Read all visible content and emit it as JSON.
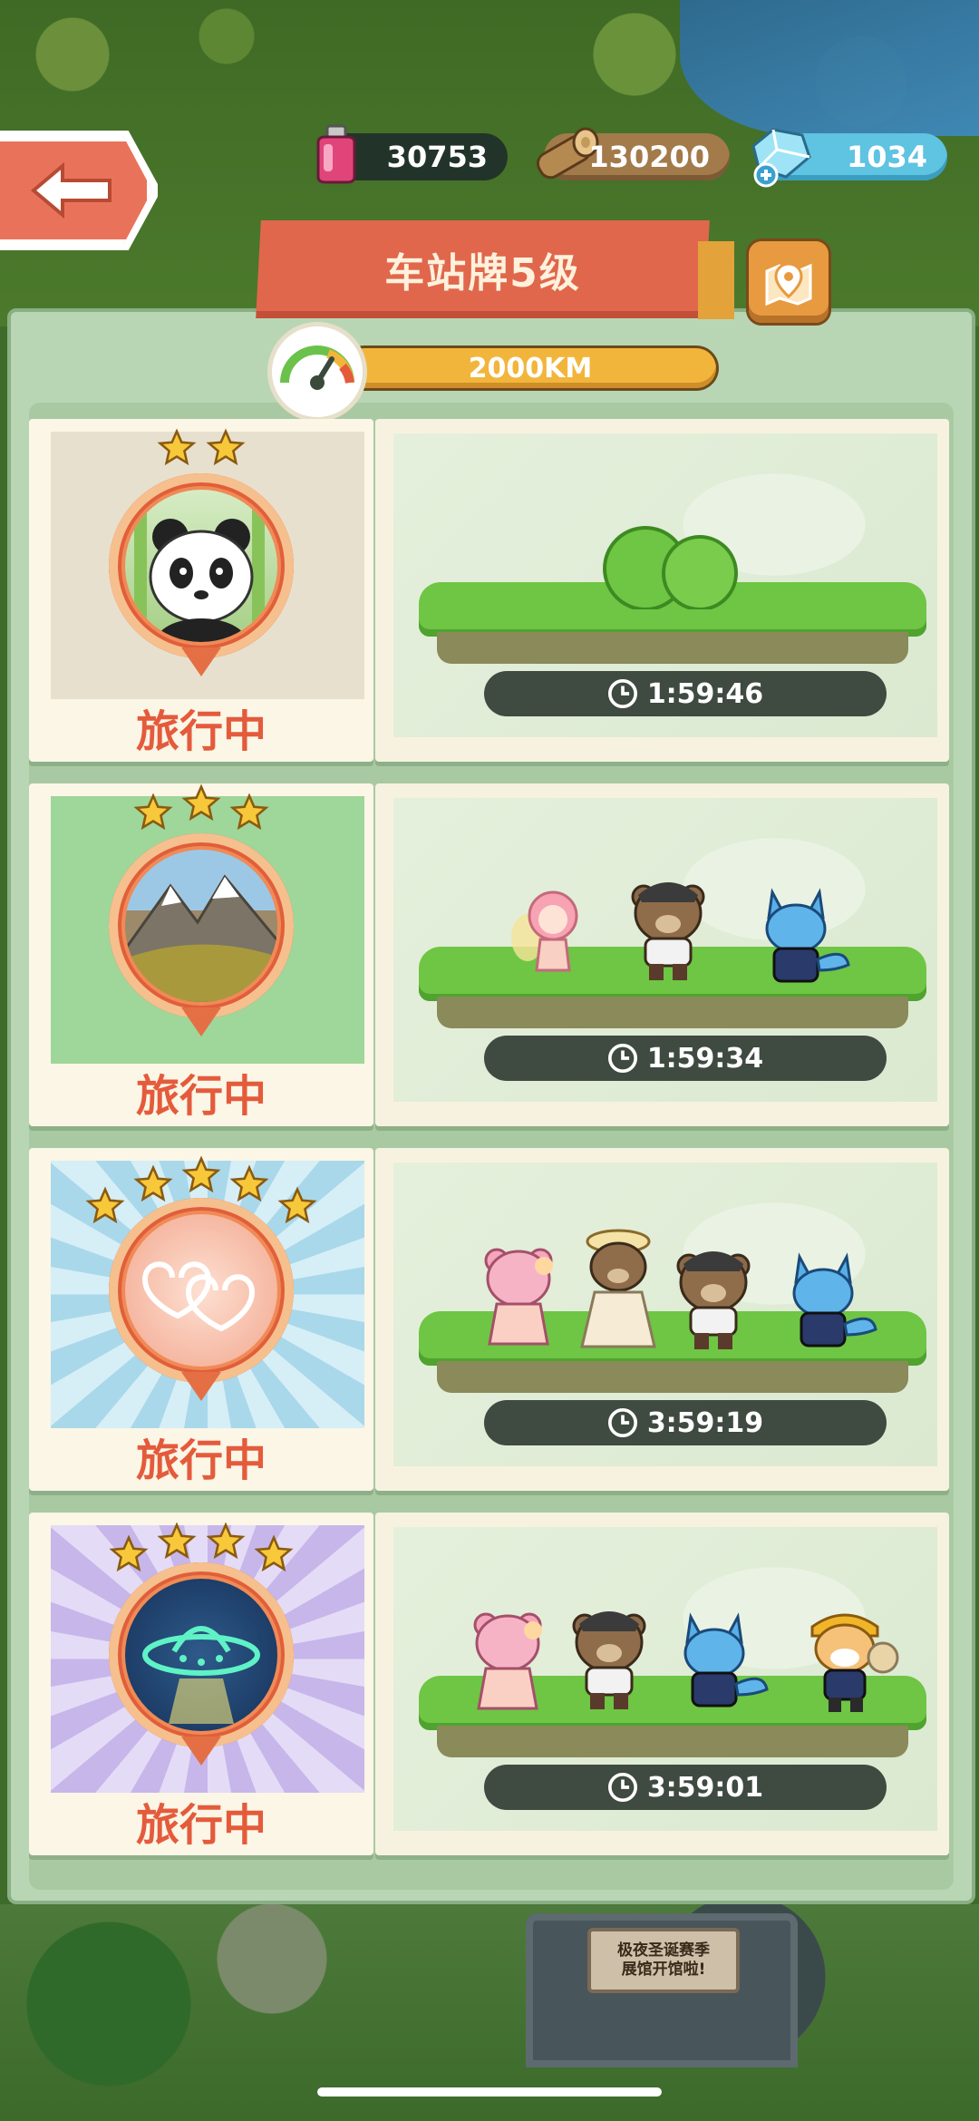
{
  "header": {
    "back_label": "",
    "title": "车站牌5级",
    "resources": {
      "ink": "30753",
      "wood": "130200",
      "gem": "1034"
    }
  },
  "speed": {
    "value": "2000KM"
  },
  "cards": [
    {
      "stars": 2,
      "theme": "panda",
      "status": "旅行中",
      "timer": "1:59:46",
      "characters": []
    },
    {
      "stars": 3,
      "theme": "mountain",
      "status": "旅行中",
      "timer": "1:59:34",
      "characters": [
        "pink-fairy",
        "brown-bear",
        "blue-wolf"
      ]
    },
    {
      "stars": 5,
      "theme": "hearts",
      "status": "旅行中",
      "timer": "3:59:19",
      "characters": [
        "pink-bear",
        "bride-bear",
        "brown-bear",
        "blue-wolf"
      ]
    },
    {
      "stars": 4,
      "theme": "ufo",
      "status": "旅行中",
      "timer": "3:59:01",
      "characters": [
        "pink-bear",
        "brown-bear",
        "blue-wolf",
        "shiba-dog"
      ]
    }
  ],
  "bottom": {
    "notice_line1": "极夜圣诞赛季",
    "notice_line2": "展馆开馆啦!"
  },
  "colors": {
    "accent": "#e0674c",
    "status_red": "#e45b3c",
    "panel_green": "#b9d6b4",
    "timer_bg": "#3f4a41",
    "speed_bar": "#f2b53c"
  },
  "icons": [
    "back-arrow-icon",
    "ink-bottle-icon",
    "wood-log-icon",
    "gem-icon",
    "map-pin-icon",
    "speed-gauge-icon",
    "clock-icon",
    "star-icon"
  ]
}
